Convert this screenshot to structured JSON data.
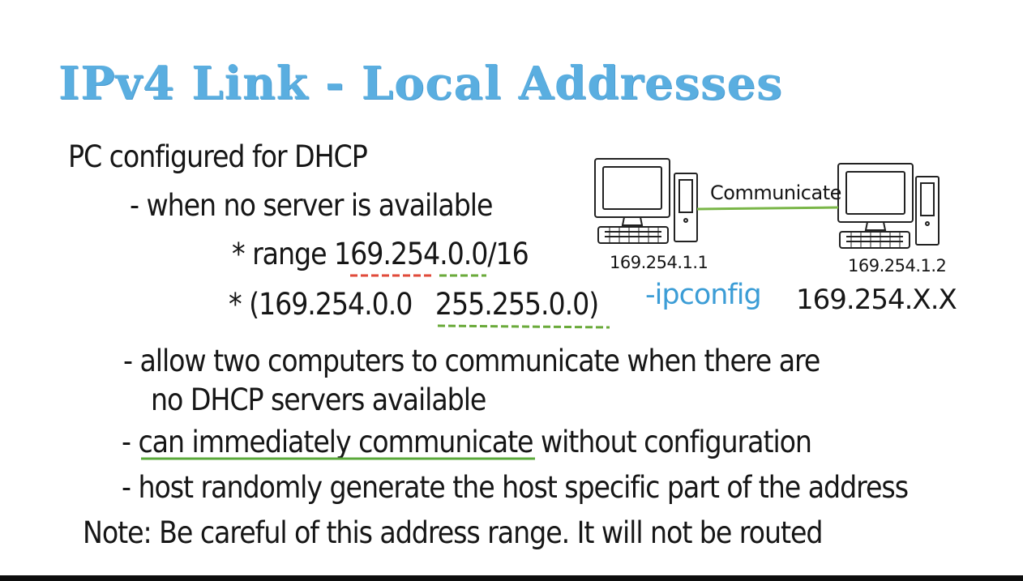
{
  "slide": {
    "title": "IPv4 Link - Local Addresses",
    "line1": "PC configured for DHCP",
    "sub1": "- when no server is available",
    "range_prefix": "* range",
    "range_a": "169.254",
    "range_dot1": ".",
    "range_b": "0.0",
    "range_c": "/16",
    "mask_prefix": "* (169.254.0.0",
    "mask_value": "255.255.0.0",
    "mask_close": ")",
    "sub2_line1": "- allow two computers to communicate when there are",
    "sub2_line2": "no DHCP servers available",
    "sub3_dash": "-",
    "sub3_underlined": "can immediately communicate",
    "sub3_rest": "without configuration",
    "sub4": "- host randomly generate the host specific part of the address",
    "note": "Note: Be careful of this address range. It will not be routed"
  },
  "diagram": {
    "link_label": "Communicate",
    "pc1_ip": "169.254.1.1",
    "pc2_ip": "169.254.1.2",
    "ipconfig_label": "-ipconfig",
    "ipconfig_value": "169.254.X.X"
  },
  "colors": {
    "title": "#5aaee0",
    "ipconfig": "#3c9dd6",
    "underline_red": "#e04a3a",
    "underline_green": "#6aaa3a",
    "link": "#7ab648"
  }
}
